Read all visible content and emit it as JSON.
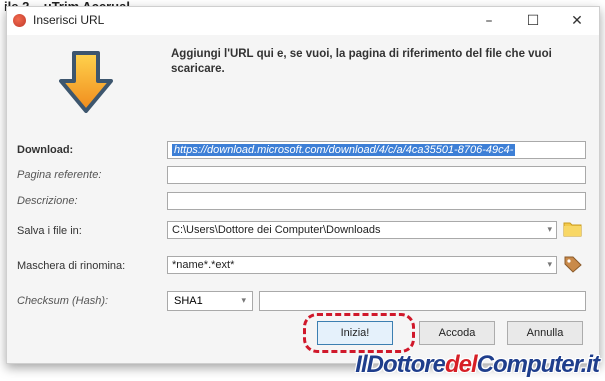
{
  "page_header": "ile 2 – uTrim Accrual",
  "window": {
    "title": "Inserisci URL",
    "controls": {
      "minimize": "–",
      "maximize": "☐",
      "close": "✕"
    }
  },
  "headline": "Aggiungi l'URL qui e, se vuoi, la pagina di riferimento del file che vuoi scaricare.",
  "form": {
    "download": {
      "label": "Download:",
      "value": "https://download.microsoft.com/download/4/c/a/4ca35501-8706-49c4-"
    },
    "referrer": {
      "label": "Pagina referente:",
      "value": ""
    },
    "description": {
      "label": "Descrizione:",
      "value": ""
    },
    "save_to": {
      "label": "Salva i file in:",
      "value": "C:\\Users\\Dottore dei Computer\\Downloads"
    },
    "rename_mask": {
      "label": "Maschera di rinomina:",
      "value": "*name*.*ext*"
    },
    "checksum": {
      "label": "Checksum (Hash):",
      "algorithm": "SHA1",
      "value": ""
    }
  },
  "buttons": {
    "start": "Inizia!",
    "queue": "Accoda",
    "cancel": "Annulla"
  },
  "icons": {
    "arrow": "download-arrow-icon",
    "folder": "folder-icon",
    "tag": "tag-icon",
    "chevron": "▾"
  },
  "watermark": {
    "part1": "IlDottore",
    "part2": "del",
    "part3": "Computer.it"
  }
}
